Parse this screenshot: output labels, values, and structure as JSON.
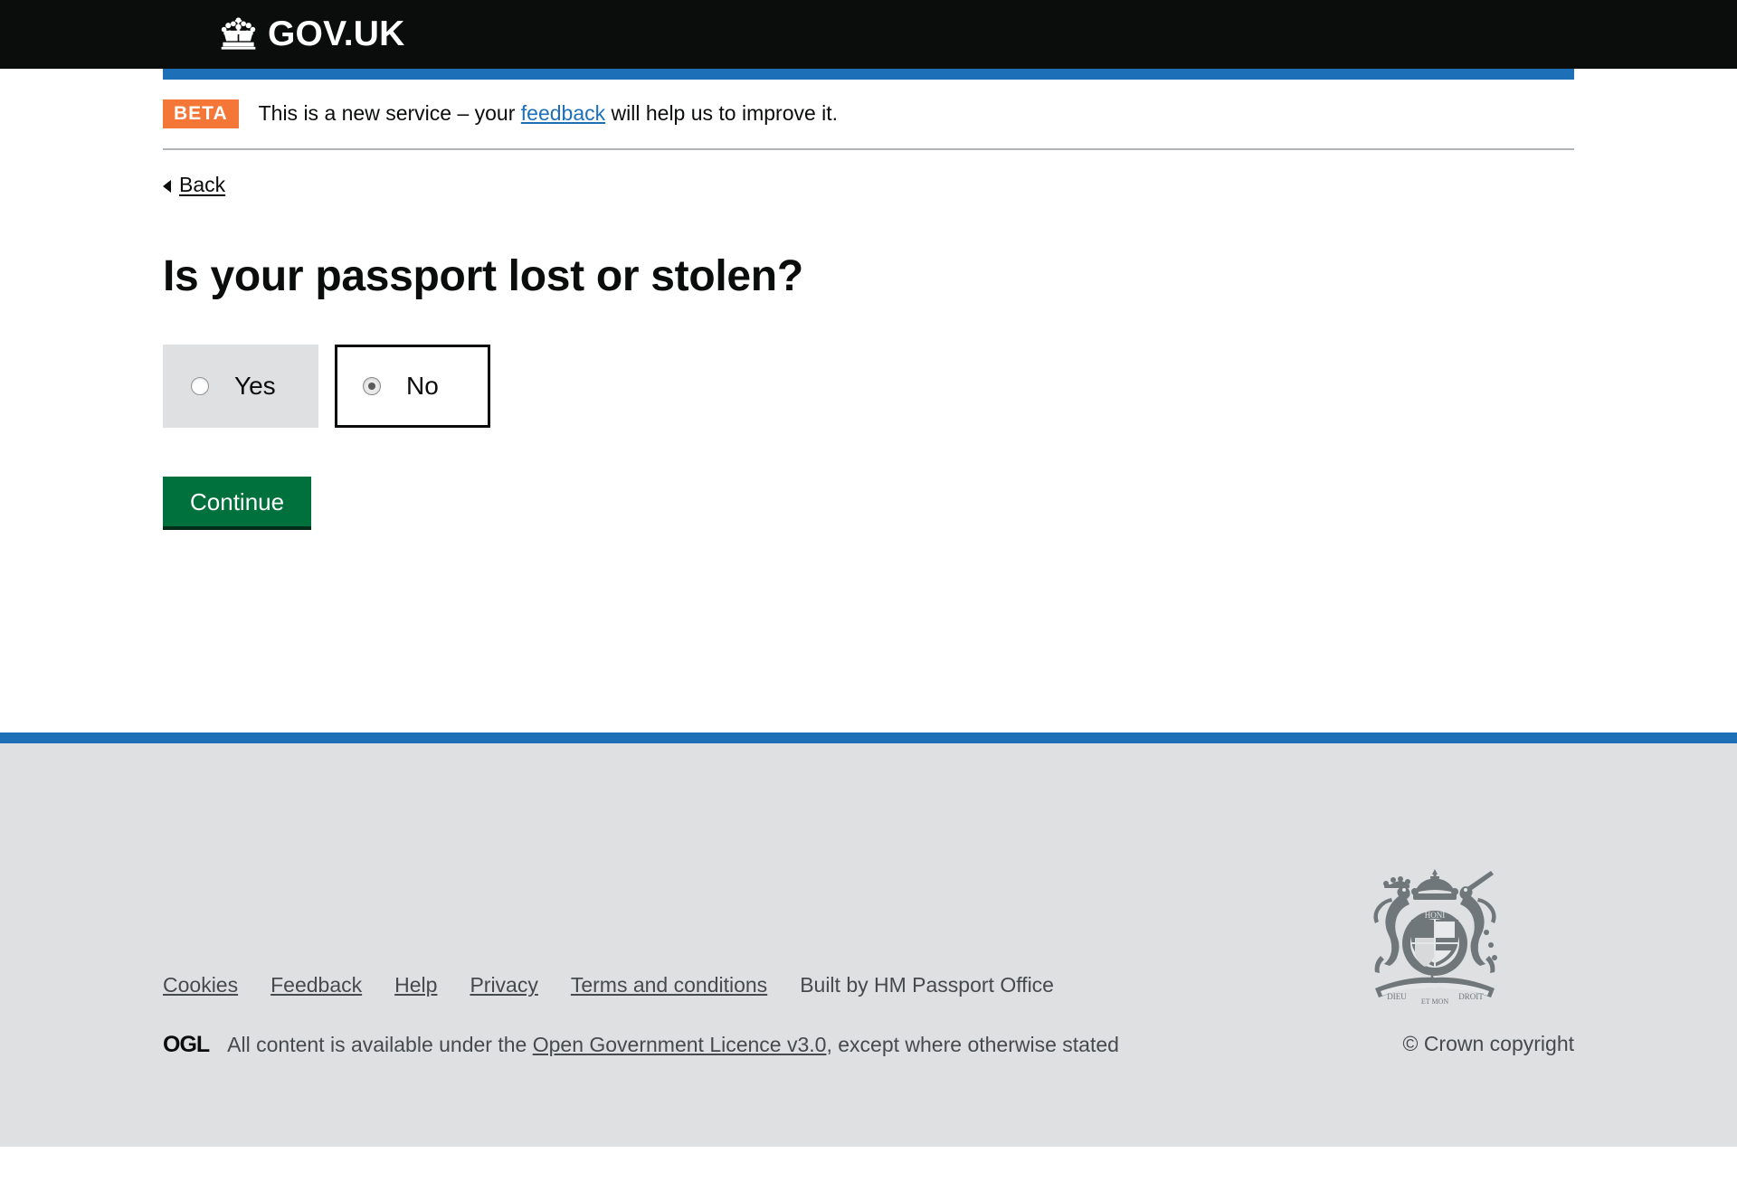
{
  "header": {
    "logo_text": "GOV.UK",
    "crown_icon": "crown-icon"
  },
  "phase_banner": {
    "tag": "BETA",
    "text_before": "This is a new service – your ",
    "link_text": "feedback",
    "text_after": " will help us to improve it."
  },
  "back": {
    "label": "Back",
    "icon": "chevron-left-icon"
  },
  "main": {
    "heading": "Is your passport lost or stolen?",
    "radios": [
      {
        "label": "Yes",
        "value": "yes",
        "checked": false,
        "state": "hovered"
      },
      {
        "label": "No",
        "value": "no",
        "checked": true,
        "state": "selected"
      }
    ],
    "continue_label": "Continue"
  },
  "footer": {
    "links": [
      {
        "label": "Cookies",
        "underlined": true
      },
      {
        "label": "Feedback",
        "underlined": true
      },
      {
        "label": "Help",
        "underlined": true
      },
      {
        "label": "Privacy",
        "underlined": true
      },
      {
        "label": "Terms and conditions",
        "underlined": true
      },
      {
        "label": "Built by HM Passport Office",
        "underlined": false
      }
    ],
    "ogl_logo": "OGL",
    "ogl_text_before": "All content is available under the ",
    "ogl_link": "Open Government Licence v3.0",
    "ogl_text_after": ", except where otherwise stated",
    "crown_copyright": "© Crown copyright",
    "royal_arms_icon": "royal-coat-of-arms-icon"
  },
  "colors": {
    "header_black": "#0b0c0c",
    "govuk_blue": "#1d70b8",
    "beta_orange": "#f47738",
    "button_green": "#00703c",
    "footer_grey": "#dee0e2",
    "link_blue": "#1d70b8",
    "footer_text": "#454a4c"
  }
}
